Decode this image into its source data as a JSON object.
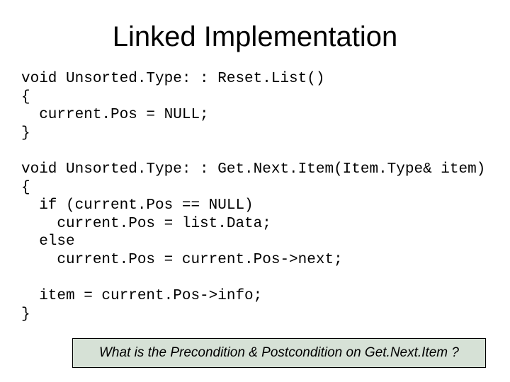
{
  "title": "Linked Implementation",
  "code": {
    "l1": "void Unsorted.Type: : Reset.List()",
    "l2": "{",
    "l3": "  current.Pos = NULL;",
    "l4": "}",
    "sp1": "",
    "l5": "void Unsorted.Type: : Get.Next.Item(Item.Type& item)",
    "l6": "{",
    "l7": "  if (current.Pos == NULL)",
    "l8": "    current.Pos = list.Data;",
    "l9": "  else",
    "l10": "    current.Pos = current.Pos->next;",
    "sp2": "",
    "l11": "  item = current.Pos->info;",
    "l12": "}"
  },
  "callout": "What is the Precondition & Postcondition on Get.Next.Item ?"
}
